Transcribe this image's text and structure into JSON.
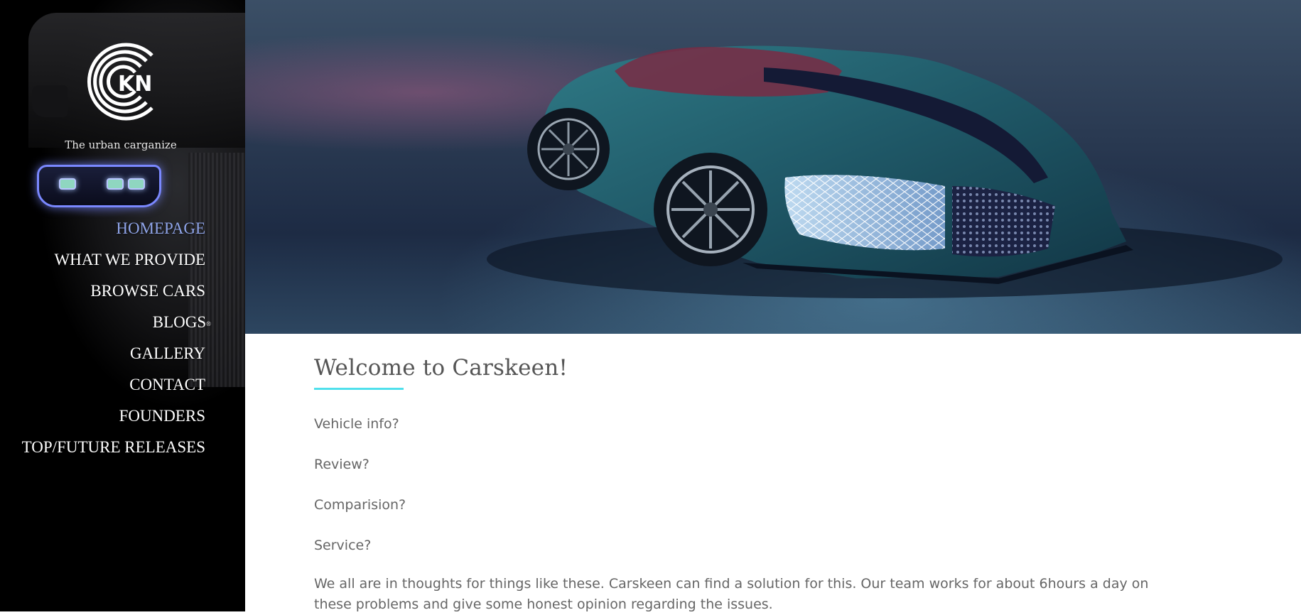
{
  "brand": {
    "logo_text": "KN",
    "tagline": "The urban carganize"
  },
  "nav": {
    "items": [
      {
        "label": "HOMEPAGE",
        "active": true
      },
      {
        "label": "WHAT WE PROVIDE"
      },
      {
        "label": "BROWSE CARS"
      },
      {
        "label": "BLOGS",
        "badge": "®"
      },
      {
        "label": "GALLERY"
      },
      {
        "label": "CONTACT"
      },
      {
        "label": "FOUNDERS"
      },
      {
        "label": "TOP/FUTURE RELEASES"
      }
    ]
  },
  "main": {
    "title": "Welcome to Carskeen!",
    "questions": [
      "Vehicle info?",
      "Review?",
      "Comparision?",
      "Service?"
    ],
    "paragraph": "We all are in thoughts for things like these. Carskeen can find a solution for this. Our team works for about 6hours a day on these problems and give some honest opinion regarding the issues."
  },
  "colors": {
    "active_nav": "#8fa4e8",
    "accent_underline": "#4fe0ec",
    "sidebar_bg": "#000000"
  }
}
